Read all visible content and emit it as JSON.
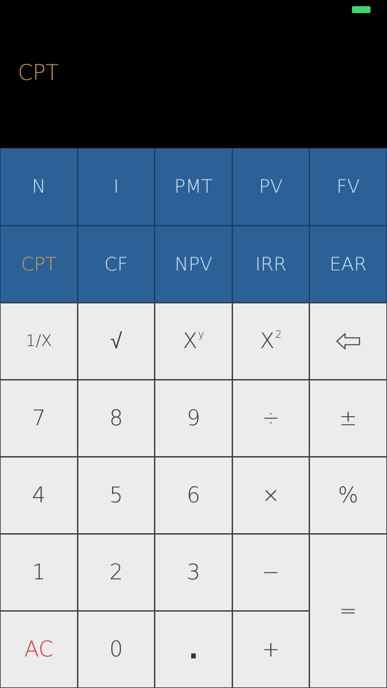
{
  "display": {
    "mode": "CPT"
  },
  "status": {
    "battery_color": "#3bd96a"
  },
  "financial_row1": [
    "N",
    "I",
    "PMT",
    "PV",
    "FV"
  ],
  "financial_row2": [
    "CPT",
    "CF",
    "NPV",
    "IRR",
    "EAR"
  ],
  "function_row": {
    "reciprocal": "1/X",
    "sqrt": "√",
    "power_base": "X",
    "power_exp": "y",
    "square_base": "X",
    "square_exp": "2",
    "backspace_icon": "backspace-arrow-icon"
  },
  "digits": {
    "d7": "7",
    "d8": "8",
    "d9": "9",
    "d4": "4",
    "d5": "5",
    "d6": "6",
    "d1": "1",
    "d2": "2",
    "d3": "3",
    "d0": "0",
    "dot": "."
  },
  "operators": {
    "divide": "÷",
    "plus_minus": "±",
    "multiply": "×",
    "percent": "%",
    "minus": "−",
    "plus": "+",
    "equals": "=",
    "clear": "AC"
  },
  "colors": {
    "financial_key_bg": "#2c6198",
    "accent_gold": "#d7a23d",
    "clear_red": "#d6233a",
    "number_key_bg": "#ececec"
  }
}
